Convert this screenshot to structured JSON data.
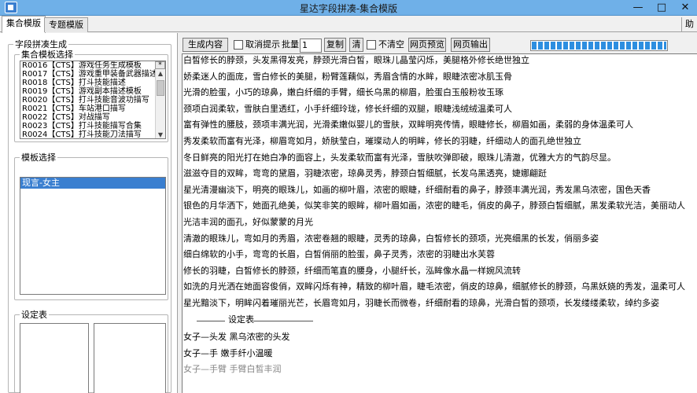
{
  "window": {
    "title": "星达字段拼凑-集合模版",
    "minimize": "—",
    "maximize": "□",
    "close": "✕"
  },
  "tabs": [
    {
      "label": "集合模版",
      "active": true
    },
    {
      "label": "专题模版",
      "active": false
    }
  ],
  "help_label": "助",
  "left": {
    "group_title": "字段拼凑生成",
    "collection_title": "集合模板选择",
    "collection_items": [
      "R0016【CTS】游戏任务生成模板",
      "R0017【CTS】游戏重甲装备武器描述",
      "R0018【CTS】打斗技能描述",
      "R0019【CTS】游戏副本描述模板",
      "R0020【CTS】打斗技能音波功描写",
      "R0021【CTS】车站港口描写",
      "R0022【CTS】对战描写",
      "R0023【CTS】打斗技能描写合集",
      "R0024【CTS】打斗技能刀法描写"
    ],
    "collection_header_btn": "*",
    "template_title": "模板选择",
    "template_items": [
      {
        "label": "现言-女主",
        "selected": true
      }
    ],
    "settings_title": "设定表"
  },
  "toolbar": {
    "generate": "生成内容",
    "cancel_tip": "取消提示",
    "batch_label": "批量",
    "batch_value": "1",
    "copy": "复制",
    "clear": "清",
    "no_clear": "不清空",
    "preview": "网页预览",
    "export": "网页输出",
    "progress_percent": 100
  },
  "text_lines": [
    {
      "text": "白皙修长的脖颈，头发黑得发亮，脖颈光滑白皙，眼珠儿晶莹闪烁，美腿格外修长绝世独立",
      "dim": false
    },
    {
      "text": "娇柔迷人的面庞，雪白修长的美腿，粉臂莲藕似，秀眉含情的水眸，眼睫浓密冰肌玉骨",
      "dim": false
    },
    {
      "text": "光滑的脸蛋，小巧的琼鼻，嫩白纤细的手臂，细长乌黑的柳眉，脸蛋白玉般粉妆玉琢",
      "dim": false
    },
    {
      "text": "颈项白润柔软，雪肤白里透红，小手纤细玲珑，修长纤细的双腿，眼睫浅绒绒温柔可人",
      "dim": false
    },
    {
      "text": "富有弹性的腰肢，颈项丰满光润，光滑柔嫩似婴儿的雪肤，双眸明亮传情，眼睫修长，柳眉如画，柔弱的身体温柔可人",
      "dim": false
    },
    {
      "text": "秀发柔软而富有光泽，柳眉弯如月，娇肤莹白，璀璨动人的明眸，修长的羽睫，纤细动人的面孔绝世独立",
      "dim": false
    },
    {
      "text": "冬日鲜亮的阳光打在她白净的面容上，头发柔软而富有光泽，雪肤吹弹即破，眼珠儿清澈，优雅大方的气韵尽显。",
      "dim": false
    },
    {
      "text": "滋滋夺目的双眸，弯弯的黛眉，羽睫浓密，琼鼻灵秀，脖颈白皙细腻，长发乌黑透亮，婕娜翩跹",
      "dim": false
    },
    {
      "text": "星光清漫幽淡下，明亮的眼珠儿，如画的柳叶眉，浓密的眼睫，纤细耐看的鼻子，脖颈丰满光润，秀发黑乌浓密，国色天香",
      "dim": false
    },
    {
      "text": "银色的月华洒下，她面孔绝美，似笑非笑的眼眸，柳叶眉如画，浓密的睫毛，俏皮的鼻子，脖颈白皙细腻，黑发柔软光洁，美丽动人",
      "dim": false
    },
    {
      "text": "光洁丰润的面孔，好似蒙蒙的月光",
      "dim": false
    },
    {
      "text": "清澈的眼珠儿，弯如月的秀眉，浓密卷翘的眼睫，灵秀的琼鼻，白皙修长的颈项，光亮细黑的长发，俏丽多姿",
      "dim": false
    },
    {
      "text": "细白绵软的小手，弯弯的长眉，白皙俏丽的脸蛋，鼻子灵秀，浓密的羽睫出水芙蓉",
      "dim": false
    },
    {
      "text": "修长的羽睫，白皙修长的脖颈，纤细而笔直的腰身，小腿纤长，泓眸像水晶一样婉风流转",
      "dim": false
    },
    {
      "text": "如洗的月光洒在她面容俊俏，双眸闪烁有神，精致的柳叶眉，睫毛浓密，俏皮的琼鼻，细腻修长的脖颈，乌黑妖娆的秀发，温柔可人",
      "dim": false
    },
    {
      "text": "星光黯淡下，明眸闪着璀丽光芒，长眉弯如月，羽睫长而微卷，纤细耐看的琼鼻，光滑白皙的颈项，长发缕缕柔软，绰约多姿",
      "dim": false
    },
    {
      "text": "设定表",
      "dim": false
    },
    {
      "text": "女子—头发    黑乌浓密的头发",
      "dim": false
    },
    {
      "text": "女子—手    嫩手纤小温暖",
      "dim": false
    },
    {
      "text": "女子—手臂    手臂白皙丰润",
      "dim": true
    }
  ]
}
